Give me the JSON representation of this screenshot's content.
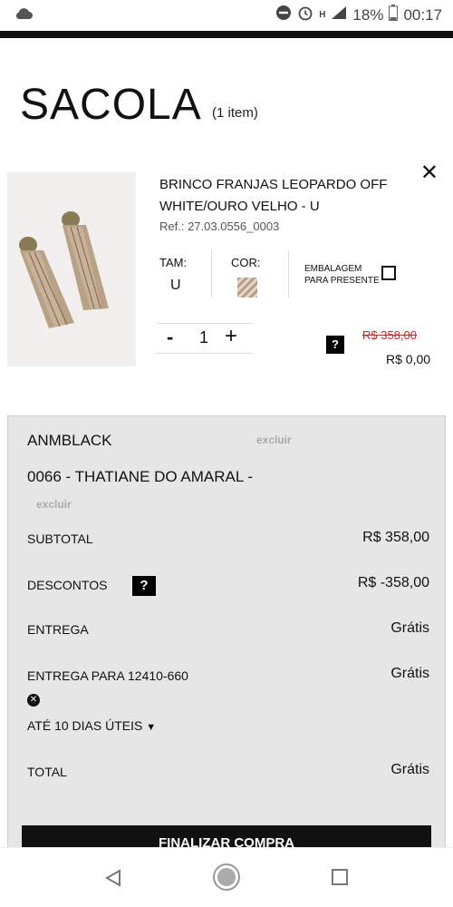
{
  "status_bar": {
    "battery": "18%",
    "time": "00:17",
    "network": "H"
  },
  "cart": {
    "title": "SACOLA",
    "count": "(1 item)"
  },
  "product": {
    "name": "BRINCO FRANJAS LEOPARDO OFF WHITE/OURO VELHO - U",
    "ref": "Ref.: 27.03.0556_0003",
    "size_label": "TAM:",
    "size_value": "U",
    "color_label": "COR:",
    "gift_label": "EMBALAGEM PARA PRESENTE",
    "quantity": "1",
    "minus": "-",
    "plus": "+",
    "old_price": "R$ 358,00",
    "new_price": "R$ 0,00",
    "help": "?"
  },
  "summary": {
    "coupon": "ANMBLACK",
    "excluir": "excluir",
    "seller": "0066 - THATIANE DO AMARAL -",
    "subtotal_label": "SUBTOTAL",
    "subtotal_value": "R$ 358,00",
    "discount_label": "DESCONTOS",
    "discount_value": "R$ -358,00",
    "delivery_label": "ENTREGA",
    "delivery_value": "Grátis",
    "delivery_to_label": "ENTREGA PARA 12410-660",
    "delivery_to_value": "Grátis",
    "delivery_time": "ATÉ 10 DIAS ÚTEIS",
    "total_label": "TOTAL",
    "total_value": "Grátis",
    "finish_button": "FINALIZAR COMPRA"
  },
  "colors": {
    "accent": "#111111",
    "strike_red": "#c2252b",
    "panel": "#e6e6e6"
  }
}
